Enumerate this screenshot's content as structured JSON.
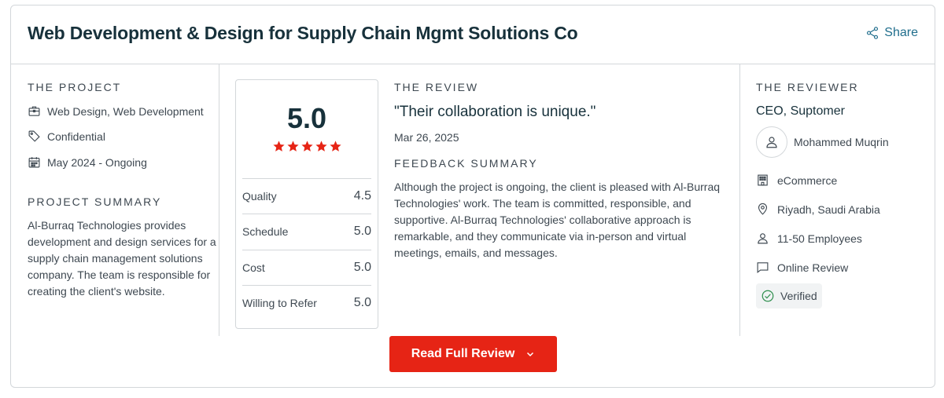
{
  "header": {
    "title": "Web Development & Design for Supply Chain Mgmt Solutions Co",
    "share_label": "Share"
  },
  "project": {
    "heading": "THE PROJECT",
    "services": "Web Design, Web Development",
    "budget": "Confidential",
    "timeline": "May 2024 - Ongoing",
    "summary_heading": "PROJECT SUMMARY",
    "summary": "Al-Burraq Technologies provides development and design services for a supply chain management solutions company. The team is responsible for creating the client's website."
  },
  "rating": {
    "overall": "5.0",
    "stars": 5,
    "scores": [
      {
        "label": "Quality",
        "value": "4.5"
      },
      {
        "label": "Schedule",
        "value": "5.0"
      },
      {
        "label": "Cost",
        "value": "5.0"
      },
      {
        "label": "Willing to Refer",
        "value": "5.0"
      }
    ]
  },
  "review": {
    "heading": "THE REVIEW",
    "quote": "\"Their collaboration is unique.\"",
    "date": "Mar 26, 2025",
    "feedback_heading": "FEEDBACK SUMMARY",
    "feedback": "Although the project is ongoing, the client is pleased with Al-Burraq Technologies' work. The team is committed, responsible, and supportive. Al-Burraq Technologies' collaborative approach is remarkable, and they communicate via in-person and virtual meetings, emails, and messages."
  },
  "reviewer": {
    "heading": "THE REVIEWER",
    "title": "CEO, Suptomer",
    "name": "Mohammed Muqrin",
    "industry": "eCommerce",
    "location": "Riyadh, Saudi Arabia",
    "company_size": "11-50 Employees",
    "review_type": "Online Review",
    "verified": "Verified"
  },
  "cta": {
    "label": "Read Full Review"
  },
  "colors": {
    "accent_red": "#e62415",
    "star_red": "#e62415",
    "link_teal": "#1f6d8c",
    "verified_green": "#2f8f4e",
    "title_dark": "#17313b"
  },
  "icons": {
    "share": "share-icon",
    "services": "briefcase-icon",
    "budget": "tag-icon",
    "timeline": "calendar-icon",
    "person": "user-icon",
    "industry": "building-icon",
    "location": "location-pin-icon",
    "size": "user-icon",
    "review_type": "chat-bubble-icon",
    "verified": "check-circle-icon",
    "chevron": "chevron-down-icon"
  }
}
